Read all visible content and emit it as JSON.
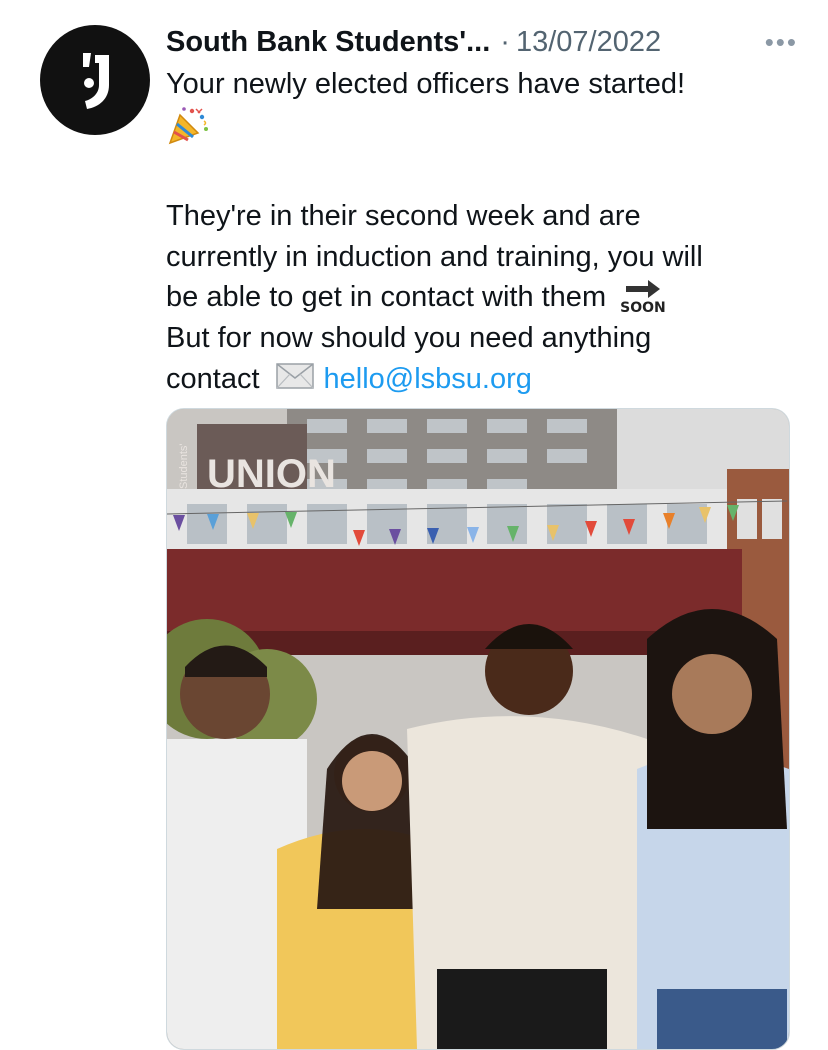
{
  "tweet": {
    "author_name": "South Bank Students'...",
    "separator": "·",
    "date": "13/07/2022",
    "more_label": "•••",
    "line1": "Your newly elected officers have started!",
    "para2_line1": "They're in their second week and are",
    "para2_line2": "currently in induction and training, you will",
    "para2_line3": "be able to get in contact with them",
    "soon_label": "SOON",
    "para2_line4": "But for now should you need anything",
    "para2_line5": "contact",
    "email_link": "hello@lsbsu.org"
  },
  "media": {
    "sign_vertical": "Students'",
    "sign_text": "UNION"
  },
  "icons": {
    "avatar": "lsbsu-logo-icon",
    "party": "party-popper-icon",
    "soon": "soon-arrow-icon",
    "mail": "envelope-icon",
    "more": "more-options-icon"
  },
  "colors": {
    "link": "#1d9bf0",
    "meta": "#536471",
    "text": "#0f1419"
  }
}
